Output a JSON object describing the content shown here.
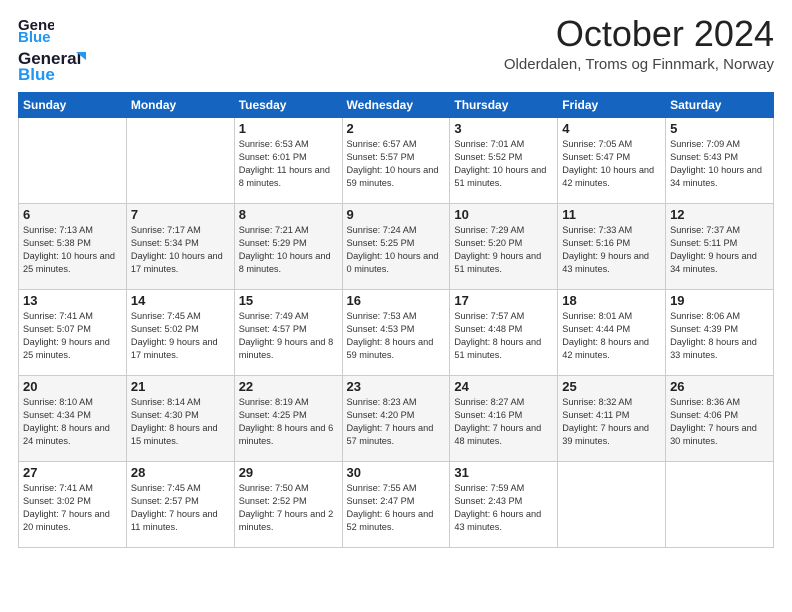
{
  "logo": {
    "line1": "General",
    "line2": "Blue"
  },
  "title": "October 2024",
  "subtitle": "Olderdalen, Troms og Finnmark, Norway",
  "weekdays": [
    "Sunday",
    "Monday",
    "Tuesday",
    "Wednesday",
    "Thursday",
    "Friday",
    "Saturday"
  ],
  "weeks": [
    [
      {
        "day": "",
        "info": ""
      },
      {
        "day": "",
        "info": ""
      },
      {
        "day": "1",
        "info": "Sunrise: 6:53 AM\nSunset: 6:01 PM\nDaylight: 11 hours and 8 minutes."
      },
      {
        "day": "2",
        "info": "Sunrise: 6:57 AM\nSunset: 5:57 PM\nDaylight: 10 hours and 59 minutes."
      },
      {
        "day": "3",
        "info": "Sunrise: 7:01 AM\nSunset: 5:52 PM\nDaylight: 10 hours and 51 minutes."
      },
      {
        "day": "4",
        "info": "Sunrise: 7:05 AM\nSunset: 5:47 PM\nDaylight: 10 hours and 42 minutes."
      },
      {
        "day": "5",
        "info": "Sunrise: 7:09 AM\nSunset: 5:43 PM\nDaylight: 10 hours and 34 minutes."
      }
    ],
    [
      {
        "day": "6",
        "info": "Sunrise: 7:13 AM\nSunset: 5:38 PM\nDaylight: 10 hours and 25 minutes."
      },
      {
        "day": "7",
        "info": "Sunrise: 7:17 AM\nSunset: 5:34 PM\nDaylight: 10 hours and 17 minutes."
      },
      {
        "day": "8",
        "info": "Sunrise: 7:21 AM\nSunset: 5:29 PM\nDaylight: 10 hours and 8 minutes."
      },
      {
        "day": "9",
        "info": "Sunrise: 7:24 AM\nSunset: 5:25 PM\nDaylight: 10 hours and 0 minutes."
      },
      {
        "day": "10",
        "info": "Sunrise: 7:29 AM\nSunset: 5:20 PM\nDaylight: 9 hours and 51 minutes."
      },
      {
        "day": "11",
        "info": "Sunrise: 7:33 AM\nSunset: 5:16 PM\nDaylight: 9 hours and 43 minutes."
      },
      {
        "day": "12",
        "info": "Sunrise: 7:37 AM\nSunset: 5:11 PM\nDaylight: 9 hours and 34 minutes."
      }
    ],
    [
      {
        "day": "13",
        "info": "Sunrise: 7:41 AM\nSunset: 5:07 PM\nDaylight: 9 hours and 25 minutes."
      },
      {
        "day": "14",
        "info": "Sunrise: 7:45 AM\nSunset: 5:02 PM\nDaylight: 9 hours and 17 minutes."
      },
      {
        "day": "15",
        "info": "Sunrise: 7:49 AM\nSunset: 4:57 PM\nDaylight: 9 hours and 8 minutes."
      },
      {
        "day": "16",
        "info": "Sunrise: 7:53 AM\nSunset: 4:53 PM\nDaylight: 8 hours and 59 minutes."
      },
      {
        "day": "17",
        "info": "Sunrise: 7:57 AM\nSunset: 4:48 PM\nDaylight: 8 hours and 51 minutes."
      },
      {
        "day": "18",
        "info": "Sunrise: 8:01 AM\nSunset: 4:44 PM\nDaylight: 8 hours and 42 minutes."
      },
      {
        "day": "19",
        "info": "Sunrise: 8:06 AM\nSunset: 4:39 PM\nDaylight: 8 hours and 33 minutes."
      }
    ],
    [
      {
        "day": "20",
        "info": "Sunrise: 8:10 AM\nSunset: 4:34 PM\nDaylight: 8 hours and 24 minutes."
      },
      {
        "day": "21",
        "info": "Sunrise: 8:14 AM\nSunset: 4:30 PM\nDaylight: 8 hours and 15 minutes."
      },
      {
        "day": "22",
        "info": "Sunrise: 8:19 AM\nSunset: 4:25 PM\nDaylight: 8 hours and 6 minutes."
      },
      {
        "day": "23",
        "info": "Sunrise: 8:23 AM\nSunset: 4:20 PM\nDaylight: 7 hours and 57 minutes."
      },
      {
        "day": "24",
        "info": "Sunrise: 8:27 AM\nSunset: 4:16 PM\nDaylight: 7 hours and 48 minutes."
      },
      {
        "day": "25",
        "info": "Sunrise: 8:32 AM\nSunset: 4:11 PM\nDaylight: 7 hours and 39 minutes."
      },
      {
        "day": "26",
        "info": "Sunrise: 8:36 AM\nSunset: 4:06 PM\nDaylight: 7 hours and 30 minutes."
      }
    ],
    [
      {
        "day": "27",
        "info": "Sunrise: 7:41 AM\nSunset: 3:02 PM\nDaylight: 7 hours and 20 minutes."
      },
      {
        "day": "28",
        "info": "Sunrise: 7:45 AM\nSunset: 2:57 PM\nDaylight: 7 hours and 11 minutes."
      },
      {
        "day": "29",
        "info": "Sunrise: 7:50 AM\nSunset: 2:52 PM\nDaylight: 7 hours and 2 minutes."
      },
      {
        "day": "30",
        "info": "Sunrise: 7:55 AM\nSunset: 2:47 PM\nDaylight: 6 hours and 52 minutes."
      },
      {
        "day": "31",
        "info": "Sunrise: 7:59 AM\nSunset: 2:43 PM\nDaylight: 6 hours and 43 minutes."
      },
      {
        "day": "",
        "info": ""
      },
      {
        "day": "",
        "info": ""
      }
    ]
  ]
}
